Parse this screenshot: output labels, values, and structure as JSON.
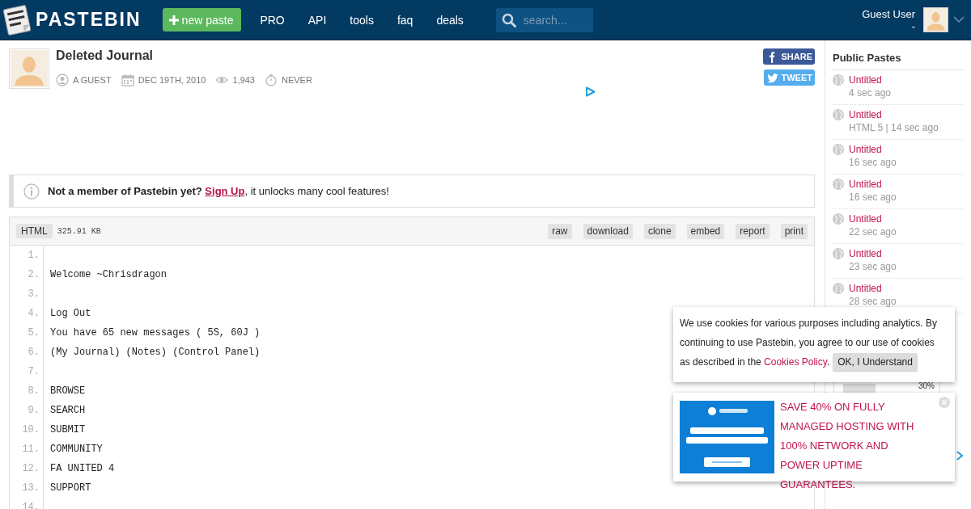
{
  "header": {
    "logo": "PASTEBIN",
    "new_paste": "new paste",
    "nav": [
      "PRO",
      "API",
      "tools",
      "faq",
      "deals"
    ],
    "search": {
      "placeholder": "search..."
    },
    "user": {
      "name": "Guest User",
      "sub": "-"
    }
  },
  "paste": {
    "title": "Deleted Journal",
    "meta": [
      {
        "kind": "user",
        "text": "A GUEST"
      },
      {
        "kind": "date",
        "text": "DEC 19TH, 2010"
      },
      {
        "kind": "views",
        "text": "1,943"
      },
      {
        "kind": "expire",
        "text": "NEVER"
      }
    ],
    "share": [
      {
        "kind": "facebook",
        "label": "SHARE"
      },
      {
        "kind": "twitter",
        "label": "TWEET"
      }
    ]
  },
  "notice": {
    "lead": "**Not a member of Pastebin yet?** ",
    "link": "Sign Up",
    "rest": ", it unlocks many cool features!"
  },
  "code": {
    "syntax": "HTML",
    "size": "325.91 KB",
    "actions": [
      "raw",
      "download",
      "clone",
      "embed",
      "report",
      "print"
    ],
    "lines": [
      {
        "number": "1."
      },
      {
        "number": "2.",
        "text": "Welcome ~Chrisdragon"
      },
      {
        "number": "3."
      },
      {
        "number": "4.",
        "text": "Log Out"
      },
      {
        "number": "5.",
        "text": "You have 65 new messages ( 5S, 60J )"
      },
      {
        "number": "6.",
        "text": "(My Journal) (Notes) (Control Panel)"
      },
      {
        "number": "7."
      },
      {
        "number": "8.",
        "text": "BROWSE"
      },
      {
        "number": "9.",
        "text": "SEARCH"
      },
      {
        "number": "10.",
        "text": "SUBMIT"
      },
      {
        "number": "11.",
        "text": "COMMUNITY"
      },
      {
        "number": "12.",
        "text": "FA UNITED 4"
      },
      {
        "number": "13.",
        "text": "SUPPORT"
      },
      {
        "number": "14."
      }
    ]
  },
  "sidebar": {
    "title": "Public Pastes",
    "items": [
      {
        "title": "Untitled",
        "meta": "4 sec ago"
      },
      {
        "title": "Untitled",
        "meta": "HTML 5 | 14 sec ago"
      },
      {
        "title": "Untitled",
        "meta": "16 sec ago"
      },
      {
        "title": "Untitled",
        "meta": "16 sec ago"
      },
      {
        "title": "Untitled",
        "meta": "22 sec ago"
      },
      {
        "title": "Untitled",
        "meta": "23 sec ago"
      },
      {
        "title": "Untitled",
        "meta": "28 sec ago"
      }
    ],
    "widget": {
      "reading": "30%"
    }
  },
  "cookie": {
    "text": "We use cookies for various purposes including analytics. By continuing to use Pastebin, you agree to our use of cookies",
    "text_end": "as described in the ",
    "link": "Cookies Policy",
    "after": ".",
    "button": "OK, I Understand"
  },
  "ad": {
    "text": "SAVE 40% ON FULLY MANAGED HOSTING WITH 100% NETWORK AND POWER UPTIME GUARANTEES."
  }
}
